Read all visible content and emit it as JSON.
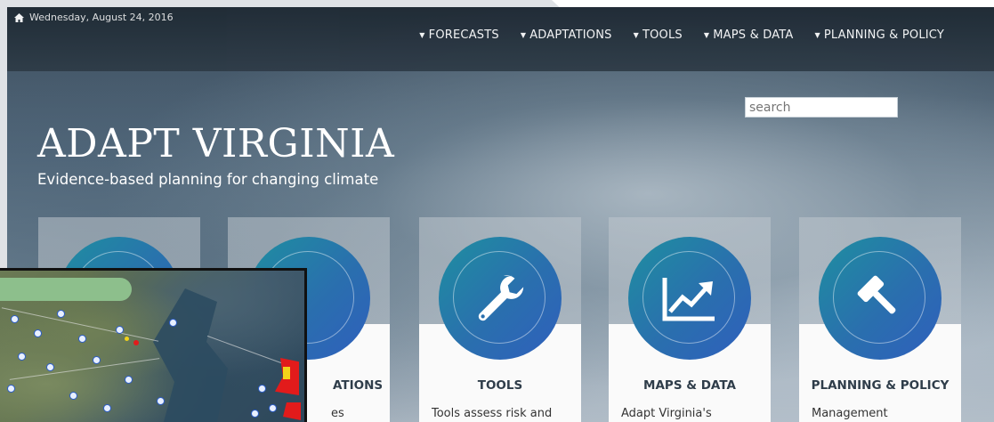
{
  "header": {
    "date": "Wednesday, August 24, 2016",
    "nav": [
      {
        "label": "FORECASTS"
      },
      {
        "label": "ADAPTATIONS"
      },
      {
        "label": "TOOLS"
      },
      {
        "label": "MAPS & DATA"
      },
      {
        "label": "PLANNING & POLICY"
      }
    ]
  },
  "search": {
    "placeholder": "search"
  },
  "hero": {
    "title": "ADAPT VIRGINIA",
    "subtitle": "Evidence-based planning for changing climate"
  },
  "cards": [
    {
      "icon": "forecast-icon",
      "title": "",
      "text": ""
    },
    {
      "icon": "lightbulb-icon",
      "title": "ATIONS",
      "text": "es"
    },
    {
      "icon": "wrench-icon",
      "title": "TOOLS",
      "text": "Tools assess risk and"
    },
    {
      "icon": "trend-chart-icon",
      "title": "MAPS & DATA",
      "text": "Adapt Virginia's"
    },
    {
      "icon": "gavel-icon",
      "title": "PLANNING & POLICY",
      "text": "Management"
    }
  ],
  "colors": {
    "nav_bg": "#26323d",
    "card_circle": "#2a6fae",
    "search_text": "#1a5cb0",
    "map_label_bar": "#8dbf8c"
  }
}
